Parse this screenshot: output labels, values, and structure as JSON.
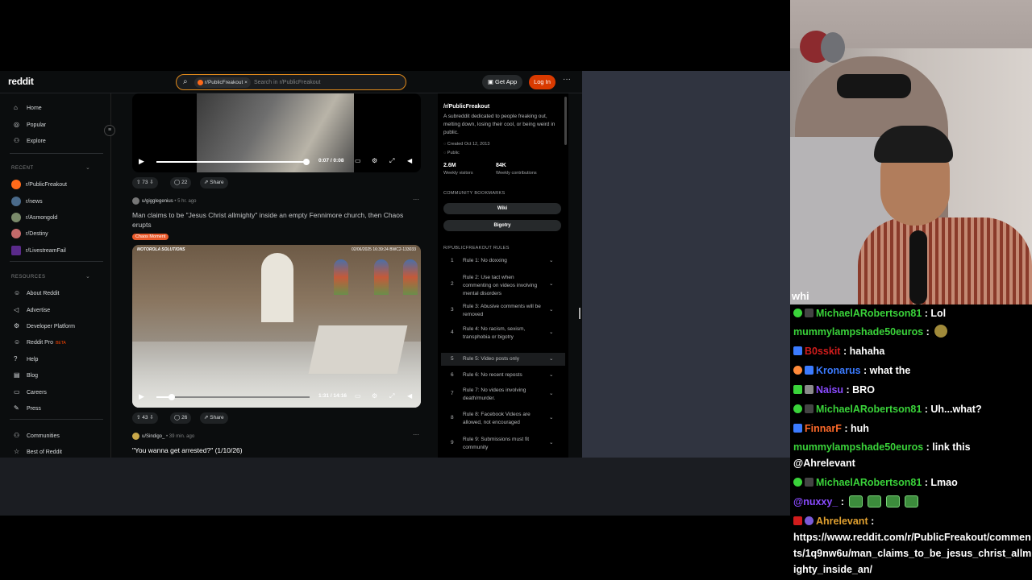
{
  "browser": {
    "logo": "reddit",
    "search": {
      "chip": "r/PublicFreakout",
      "chip_close": "×",
      "placeholder": "Search in r/PublicFreakout"
    },
    "get_app": "Get App",
    "login": "Log In",
    "more": "···"
  },
  "nav": {
    "main": [
      {
        "label": "Home",
        "icon": "home-icon"
      },
      {
        "label": "Popular",
        "icon": "popular-icon"
      },
      {
        "label": "Explore",
        "icon": "explore-icon"
      }
    ],
    "recent_header": "RECENT",
    "recent": [
      "r/PublicFreakout",
      "r/news",
      "r/Asmongold",
      "r/Destiny",
      "r/LivestreamFail"
    ],
    "resources_header": "RESOURCES",
    "resources": [
      "About Reddit",
      "Advertise",
      "Developer Platform",
      "Reddit Pro",
      "Help",
      "Blog",
      "Careers",
      "Press"
    ],
    "beta": "BETA",
    "bottom": [
      "Communities",
      "Best of Reddit"
    ]
  },
  "feed": {
    "video1": {
      "time": "0:07 / 0:08",
      "progress": 1.0
    },
    "post1_actions": {
      "votes": "73",
      "comments": "22",
      "share": "Share"
    },
    "post2": {
      "user": "u/gigglegenius",
      "age": "• 5 hr. ago",
      "title": "Man claims to be \"Jesus Christ allmighty\" inside an empty Fennimore church, then Chaos erupts",
      "flair": "Chaos Moment",
      "osd_brand": "MOTOROLA SOLUTIONS",
      "osd_stamp": "02/06/2025 16:39:24  BWC2-133033",
      "time": "1:31 / 14:16",
      "progress": 0.1,
      "votes": "43",
      "comments": "26",
      "share": "Share"
    },
    "post3": {
      "user": "u/Sindigo_",
      "age": "• 39 min. ago",
      "title": "\"You wanna get arrested?\" (1/10/26)"
    }
  },
  "sidebar": {
    "title": "/r/PublicFreakout",
    "description": "A subreddit dedicated to people freaking out, melting down, losing their cool, or being weird in public.",
    "created": "Created Oct 12, 2013",
    "visibility": "Public",
    "stats": [
      {
        "value": "2.6M",
        "label": "Weekly visitors"
      },
      {
        "value": "84K",
        "label": "Weekly contributions"
      }
    ],
    "bookmarks_header": "COMMUNITY BOOKMARKS",
    "bookmarks": [
      "Wiki",
      "Bigotry"
    ],
    "rules_header": "R/PUBLICFREAKOUT RULES",
    "rules": [
      {
        "n": "1",
        "text": "Rule 1: No doxxing"
      },
      {
        "n": "2",
        "text": "Rule 2: Use tact when commenting on videos involving mental disorders"
      },
      {
        "n": "3",
        "text": "Rule 3: Abusive comments will be removed"
      },
      {
        "n": "4",
        "text": "Rule 4: No racism, sexism, transphobia or bigotry"
      },
      {
        "n": "5",
        "text": "Rule 5: Video posts only"
      },
      {
        "n": "6",
        "text": "Rule 6: No recent reposts"
      },
      {
        "n": "7",
        "text": "Rule 7: No videos involving death/murder."
      },
      {
        "n": "8",
        "text": "Rule 8: Facebook Videos are allowed, not encouraged"
      },
      {
        "n": "9",
        "text": "Rule 9: Submissions must fit community"
      }
    ]
  },
  "webcam": {
    "caption": "whi"
  },
  "chat": [
    {
      "user": "MichaelARobertson81",
      "color": "#3ad33a",
      "text": " : Lol"
    },
    {
      "user": "mummylampshade50euros",
      "color": "#3ad33a",
      "text": " : "
    },
    {
      "user": "B0sskit",
      "color": "#d11c1c",
      "text": " : hahaha"
    },
    {
      "user": "Kronarus",
      "color": "#3b7bff",
      "text": " : what the"
    },
    {
      "user": "Naisu",
      "color": "#8a4bff",
      "text": " : BRO"
    },
    {
      "user": "MichaelARobertson81",
      "color": "#3ad33a",
      "text": " : Uh...what?"
    },
    {
      "user": "FinnarF",
      "color": "#ff6a2a",
      "text": " : huh"
    },
    {
      "user": "mummylampshade50euros",
      "color": "#3ad33a",
      "text": " : link this @Ahrelevant"
    },
    {
      "user": "MichaelARobertson81",
      "color": "#3ad33a",
      "text": " : Lmao"
    },
    {
      "user": "@nuxxy_",
      "color": "#8a4bff",
      "text": " : "
    },
    {
      "user": "Ahrelevant",
      "color": "#e0a030",
      "text": " :"
    },
    {
      "user": "",
      "color": "#ffffff",
      "text": "https://www.reddit.com/r/PublicFreakout/comments/1q9nw6u/man_claims_to_be_jesus_christ_allmighty_inside_an/"
    }
  ]
}
